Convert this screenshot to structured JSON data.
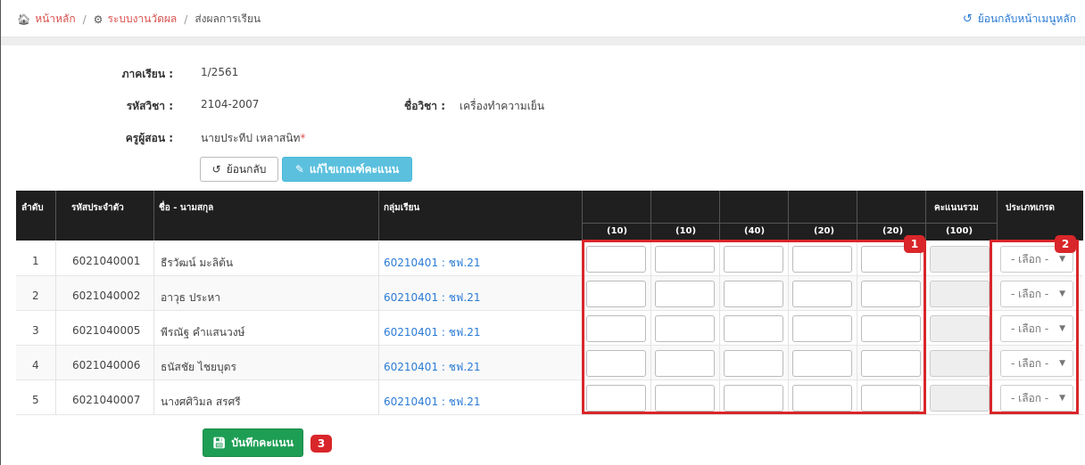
{
  "breadcrumb": {
    "home": "หน้าหลัก",
    "section": "ระบบงานวัดผล",
    "current": "ส่งผลการเรียน",
    "home_icon": "home-icon",
    "section_icon": "cogs-icon"
  },
  "back_to_menu": {
    "label": "ย้อนกลับหน้าเมนูหลัก",
    "icon": "undo-icon"
  },
  "info": {
    "semester_label": "ภาคเรียน :",
    "semester_value": "1/2561",
    "subject_code_label": "รหัสวิชา :",
    "subject_code_value": "2104-2007",
    "subject_name_label": "ชื่อวิชา :",
    "subject_name_value": "เครื่องทำความเย็น",
    "teacher_label": "ครูผู้สอน :",
    "teacher_value": "นายประทีป เหลาสนิท",
    "required_mark": "*"
  },
  "buttons": {
    "back": "ย้อนกลับ",
    "back_icon": "undo-icon",
    "edit_criteria": "แก้ไขเกณฑ์คะแนน",
    "edit_icon": "edit-icon",
    "save": "บันทึกคะแนน",
    "save_icon": "save-icon"
  },
  "table": {
    "headers": {
      "no": "ลำดับ",
      "student_id": "รหัสประจำตัว",
      "name": "ชื่อ - นามสกุล",
      "group": "กลุ่มเรียน",
      "total": "คะแนนรวม",
      "grade_type": "ประเภทเกรด"
    },
    "score_maxes": [
      "(10)",
      "(10)",
      "(40)",
      "(20)",
      "(20)"
    ],
    "total_max": "(100)",
    "grade_placeholder": "- เลือก -",
    "rows": [
      {
        "no": "1",
        "student_id": "6021040001",
        "name": "ธีรวัฒน์ มะลิต้น",
        "group": "60210401 : ชฟ.21"
      },
      {
        "no": "2",
        "student_id": "6021040002",
        "name": "อาวุธ ประหา",
        "group": "60210401 : ชฟ.21"
      },
      {
        "no": "3",
        "student_id": "6021040005",
        "name": "พีรณัฐ คำแสนวงษ์",
        "group": "60210401 : ชฟ.21"
      },
      {
        "no": "4",
        "student_id": "6021040006",
        "name": "ธนัสชัย ไชยบุตร",
        "group": "60210401 : ชฟ.21"
      },
      {
        "no": "5",
        "student_id": "6021040007",
        "name": "นางศศิวิมล สรศรี",
        "group": "60210401 : ชฟ.21"
      }
    ]
  },
  "annotations": [
    "1",
    "2",
    "3"
  ],
  "colors": {
    "highlight": "#d9262a",
    "link": "#2a7bd5",
    "header_bg": "#1f1f1f",
    "save_button": "#1e9e55",
    "edit_button": "#5bc0de"
  }
}
